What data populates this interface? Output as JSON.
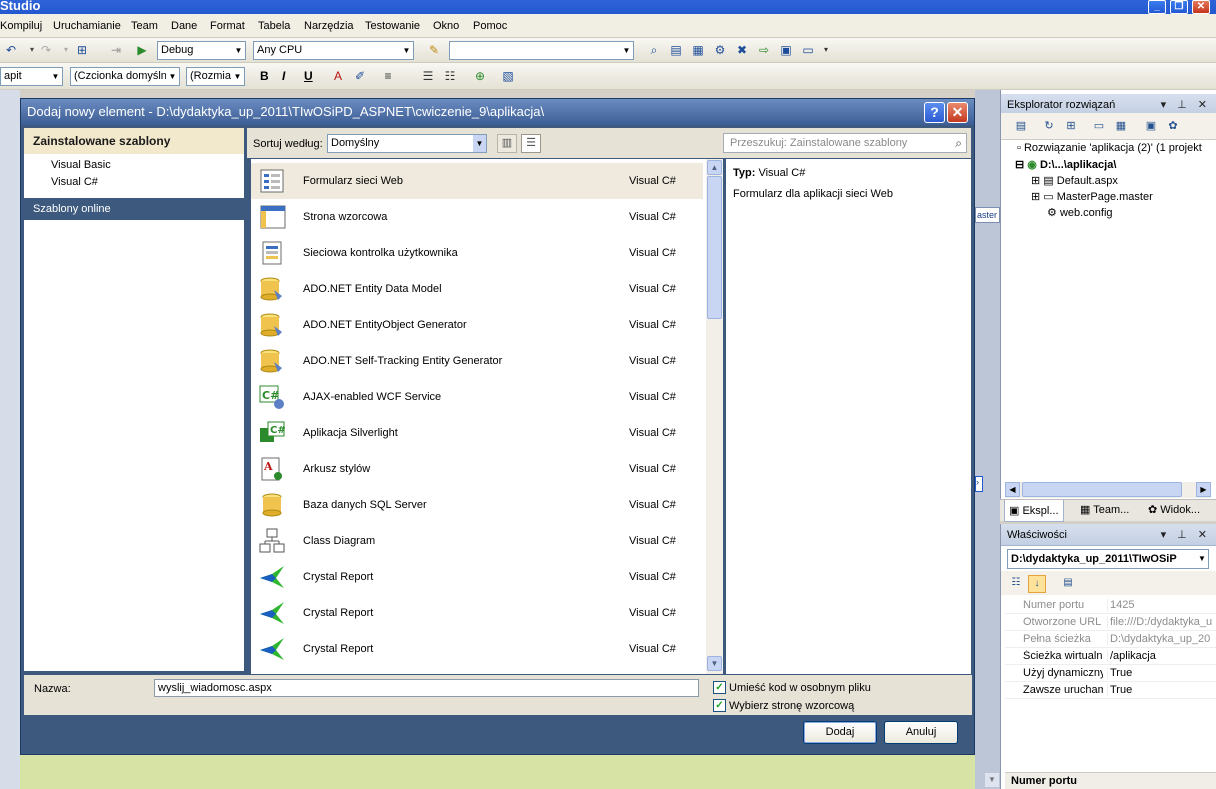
{
  "window": {
    "title": "Studio"
  },
  "menu": [
    "Kompiluj",
    "Uruchamianie",
    "Team",
    "Dane",
    "Format",
    "Tabela",
    "Narzędzia",
    "Testowanie",
    "Okno",
    "Pomoc"
  ],
  "toolbar1": {
    "config": "Debug",
    "platform": "Any CPU",
    "find": ""
  },
  "toolbar2": {
    "style": "apit",
    "font": "(Czcionka domyślna",
    "size": "(Rozmiar",
    "bold": "B",
    "italic": "I",
    "underline": "U"
  },
  "dialog": {
    "title": "Dodaj nowy element - D:\\dydaktyka_up_2011\\TIwOSiPD_ASPNET\\cwiczenie_9\\aplikacja\\",
    "installed_header": "Zainstalowane szablony",
    "languages": [
      "Visual Basic",
      "Visual C#"
    ],
    "online": "Szablony online",
    "sort_label": "Sortuj według:",
    "sort_value": "Domyślny",
    "search_placeholder": "Przeszukuj: Zainstalowane szablony",
    "templates": [
      {
        "name": "Formularz sieci Web",
        "lang": "Visual C#",
        "icon": "web-form-icon"
      },
      {
        "name": "Strona wzorcowa",
        "lang": "Visual C#",
        "icon": "master-page-icon"
      },
      {
        "name": "Sieciowa kontrolka użytkownika",
        "lang": "Visual C#",
        "icon": "user-control-icon"
      },
      {
        "name": "ADO.NET Entity Data Model",
        "lang": "Visual C#",
        "icon": "entity-model-icon"
      },
      {
        "name": "ADO.NET EntityObject Generator",
        "lang": "Visual C#",
        "icon": "entity-generator-icon"
      },
      {
        "name": "ADO.NET Self-Tracking Entity Generator",
        "lang": "Visual C#",
        "icon": "self-tracking-icon"
      },
      {
        "name": "AJAX-enabled WCF Service",
        "lang": "Visual C#",
        "icon": "wcf-service-icon"
      },
      {
        "name": "Aplikacja Silverlight",
        "lang": "Visual C#",
        "icon": "silverlight-icon"
      },
      {
        "name": "Arkusz stylów",
        "lang": "Visual C#",
        "icon": "stylesheet-icon"
      },
      {
        "name": "Baza danych SQL Server",
        "lang": "Visual C#",
        "icon": "database-icon"
      },
      {
        "name": "Class Diagram",
        "lang": "Visual C#",
        "icon": "class-diagram-icon"
      },
      {
        "name": "Crystal Report",
        "lang": "Visual C#",
        "icon": "crystal-report-icon"
      },
      {
        "name": "Crystal Report",
        "lang": "Visual C#",
        "icon": "crystal-report-icon"
      },
      {
        "name": "Crystal Report",
        "lang": "Visual C#",
        "icon": "crystal-report-icon"
      }
    ],
    "info_type_label": "Typ:",
    "info_type_value": "Visual C#",
    "info_desc": "Formularz dla aplikacji sieci Web",
    "name_label": "Nazwa:",
    "name_value": "wyslij_wiadomosc.aspx",
    "check1": "Umieść kod w osobnym pliku",
    "check2": "Wybierz stronę wzorcową",
    "add": "Dodaj",
    "cancel": "Anuluj"
  },
  "solution_explorer": {
    "title": "Eksplorator rozwiązań",
    "solution": "Rozwiązanie 'aplikacja (2)' (1 projekt",
    "project": "D:\\...\\aplikacja\\",
    "files": [
      "Default.aspx",
      "MasterPage.master",
      "web.config"
    ],
    "tabs": [
      "Ekspl...",
      "Team...",
      "Widok..."
    ]
  },
  "properties": {
    "title": "Właściwości",
    "object": "D:\\dydaktyka_up_2011\\TIwOSiP",
    "rows": [
      {
        "k": "Numer portu",
        "v": "1425",
        "dim": true
      },
      {
        "k": "Otworzone URL",
        "v": "file:///D:/dydaktyka_u",
        "dim": true
      },
      {
        "k": "Pełna ścieżka",
        "v": "D:\\dydaktyka_up_20",
        "dim": true
      },
      {
        "k": "Ścieżka wirtualna",
        "v": "/aplikacja",
        "dim": false
      },
      {
        "k": "Użyj dynamiczny",
        "v": "True",
        "dim": false
      },
      {
        "k": "Zawsze urucham",
        "v": "True",
        "dim": false
      }
    ],
    "footer": "Numer portu"
  },
  "side_tab": "aster"
}
